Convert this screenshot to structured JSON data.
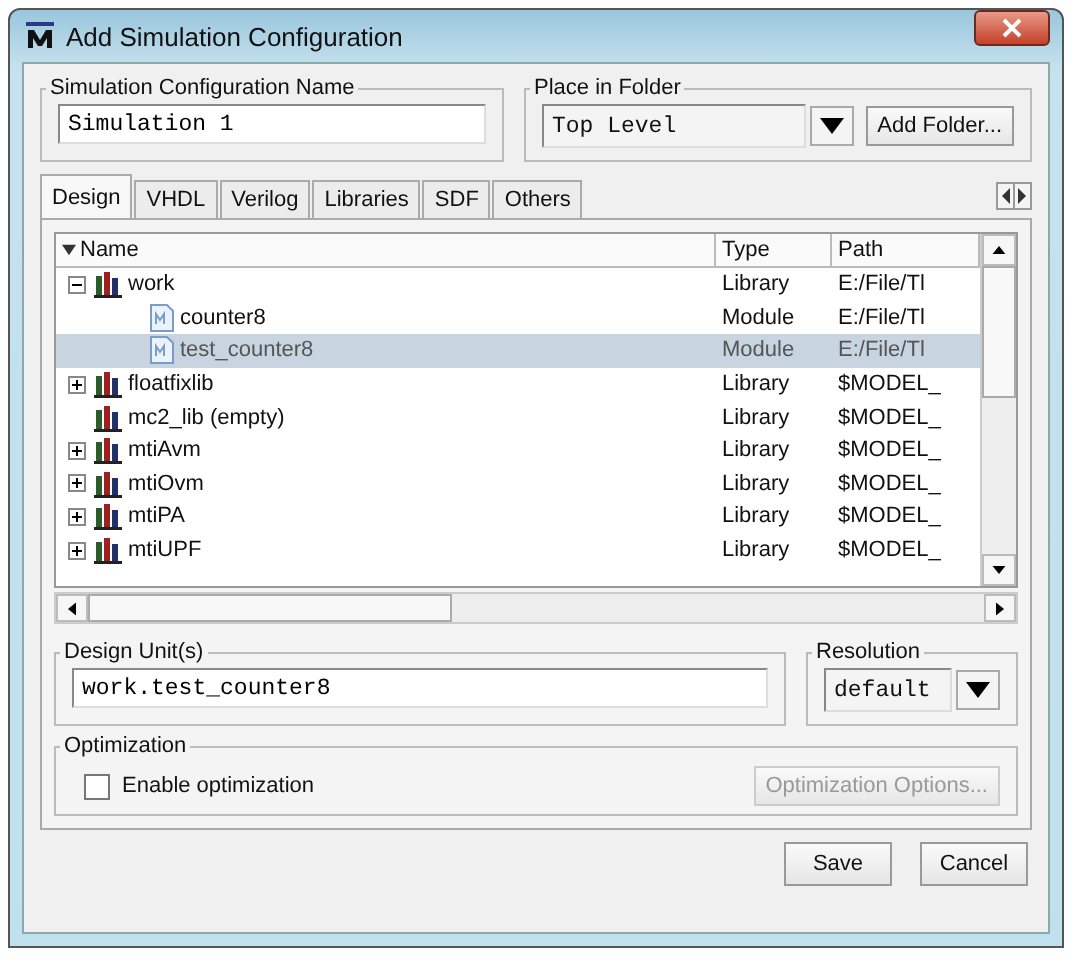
{
  "window": {
    "title": "Add Simulation Configuration"
  },
  "config_name": {
    "label": "Simulation Configuration Name",
    "value": "Simulation 1"
  },
  "place_in_folder": {
    "label": "Place in Folder",
    "value": "Top Level",
    "button": "Add Folder..."
  },
  "tabs": [
    {
      "label": "Design",
      "selected": true
    },
    {
      "label": "VHDL",
      "selected": false
    },
    {
      "label": "Verilog",
      "selected": false
    },
    {
      "label": "Libraries",
      "selected": false
    },
    {
      "label": "SDF",
      "selected": false
    },
    {
      "label": "Others",
      "selected": false
    }
  ],
  "tree": {
    "columns": [
      "Name",
      "Type",
      "Path"
    ],
    "rows": [
      {
        "name": "work",
        "type": "Library",
        "path": "E:/File/Tl",
        "kind": "library",
        "expanded": true,
        "selected": false,
        "children": [
          {
            "name": "counter8",
            "type": "Module",
            "path": "E:/File/Tl",
            "kind": "module",
            "selected": false
          },
          {
            "name": "test_counter8",
            "type": "Module",
            "path": "E:/File/Tl",
            "kind": "module",
            "selected": true
          }
        ]
      },
      {
        "name": "floatfixlib",
        "type": "Library",
        "path": "$MODEL_",
        "kind": "library",
        "expanded": false,
        "selected": false
      },
      {
        "name": "mc2_lib  (empty)",
        "type": "Library",
        "path": "$MODEL_",
        "kind": "library",
        "selected": false
      },
      {
        "name": "mtiAvm",
        "type": "Library",
        "path": "$MODEL_",
        "kind": "library",
        "expanded": false,
        "selected": false
      },
      {
        "name": "mtiOvm",
        "type": "Library",
        "path": "$MODEL_",
        "kind": "library",
        "expanded": false,
        "selected": false
      },
      {
        "name": "mtiPA",
        "type": "Library",
        "path": "$MODEL_",
        "kind": "library",
        "expanded": false,
        "selected": false
      },
      {
        "name": "mtiUPF",
        "type": "Library",
        "path": "$MODEL_",
        "kind": "library",
        "expanded": false,
        "selected": false
      }
    ]
  },
  "design_units": {
    "label": "Design Unit(s)",
    "value": "work.test_counter8"
  },
  "resolution": {
    "label": "Resolution",
    "value": "default"
  },
  "optimization": {
    "label": "Optimization",
    "checkbox": {
      "label": "Enable optimization",
      "checked": false
    },
    "button": {
      "label": "Optimization Options...",
      "disabled": true
    }
  },
  "buttons": [
    "Save",
    "Cancel"
  ]
}
